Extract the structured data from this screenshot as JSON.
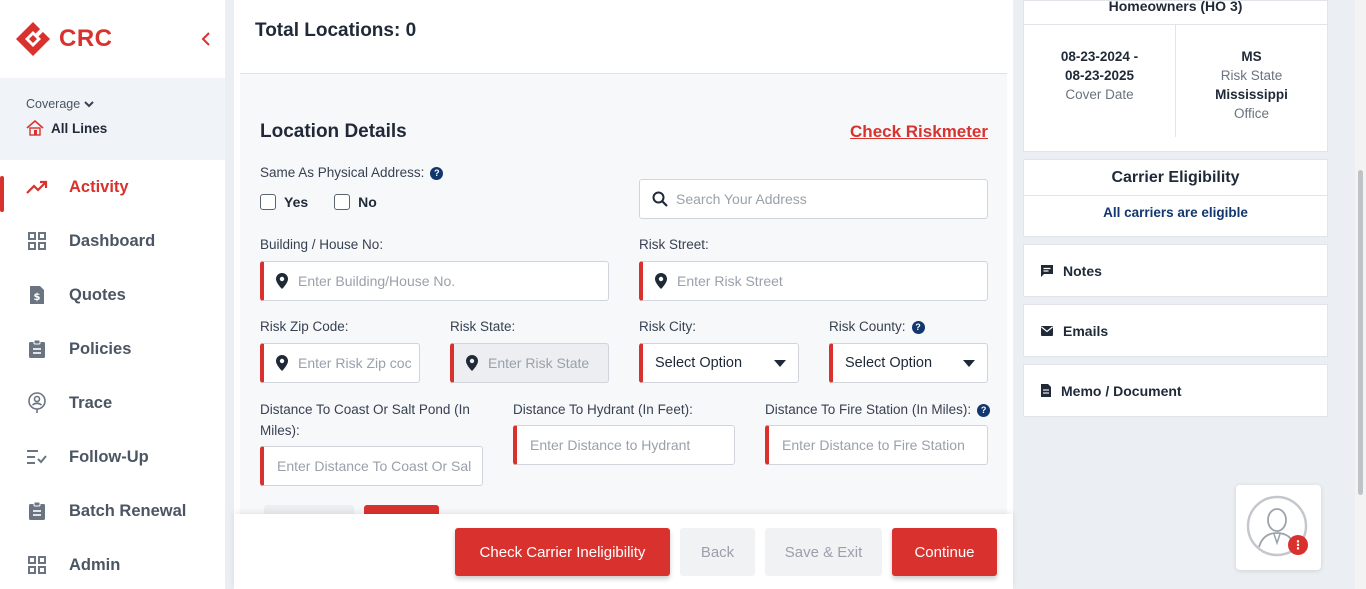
{
  "app": {
    "logo_text": "CRC",
    "brand_color": "#d9322e",
    "accent_navy": "#12376f"
  },
  "sidebar": {
    "coverage_label": "Coverage",
    "coverage_value": "All Lines",
    "items": [
      {
        "label": "Activity",
        "icon": "activity-trend-icon",
        "active": true
      },
      {
        "label": "Dashboard",
        "icon": "grid-icon"
      },
      {
        "label": "Quotes",
        "icon": "dollar-document-icon"
      },
      {
        "label": "Policies",
        "icon": "clipboard-icon"
      },
      {
        "label": "Trace",
        "icon": "location-user-icon"
      },
      {
        "label": "Follow-Up",
        "icon": "list-check-icon"
      },
      {
        "label": "Batch Renewal",
        "icon": "clipboard-icon"
      },
      {
        "label": "Admin",
        "icon": "grid-icon"
      }
    ]
  },
  "main": {
    "total_locations": "Total Locations: 0",
    "section_title": "Location Details",
    "check_riskmeter": "Check Riskmeter",
    "same_as_physical_label": "Same As Physical Address:",
    "yes_label": "Yes",
    "no_label": "No",
    "search_placeholder": "Search Your Address",
    "building_label": "Building / House No:",
    "building_placeholder": "Enter Building/House No.",
    "risk_street_label": "Risk Street:",
    "risk_street_placeholder": "Enter Risk Street",
    "zip_label": "Risk Zip Code:",
    "zip_placeholder": "Enter Risk Zip coc",
    "state_label": "Risk State:",
    "state_placeholder": "Enter Risk State",
    "city_label": "Risk City:",
    "city_value": "Select Option",
    "county_label": "Risk County:",
    "county_value": "Select Option",
    "coast_label": "Distance To Coast Or Salt Pond (In Miles):",
    "coast_placeholder": "Enter Distance To Coast Or Sal",
    "hydrant_label": "Distance To Hydrant (In Feet):",
    "hydrant_placeholder": "Enter Distance to Hydrant",
    "fire_label": "Distance To Fire Station (In Miles):",
    "fire_placeholder": "Enter Distance to Fire Station"
  },
  "footer": {
    "check_ineligibility": "Check Carrier Ineligibility",
    "back": "Back",
    "save_exit": "Save & Exit",
    "continue": "Continue"
  },
  "right": {
    "policy_title": "Homeowners (HO 3)",
    "cover_date_range_1": "08-23-2024 -",
    "cover_date_range_2": "08-23-2025",
    "cover_date_label": "Cover Date",
    "state_code": "MS",
    "risk_state_label": "Risk State",
    "office_name": "Mississippi",
    "office_label": "Office",
    "eligibility_title": "Carrier Eligibility",
    "eligibility_text": "All carriers are eligible",
    "notes": "Notes",
    "emails": "Emails",
    "memo": "Memo / Document"
  }
}
